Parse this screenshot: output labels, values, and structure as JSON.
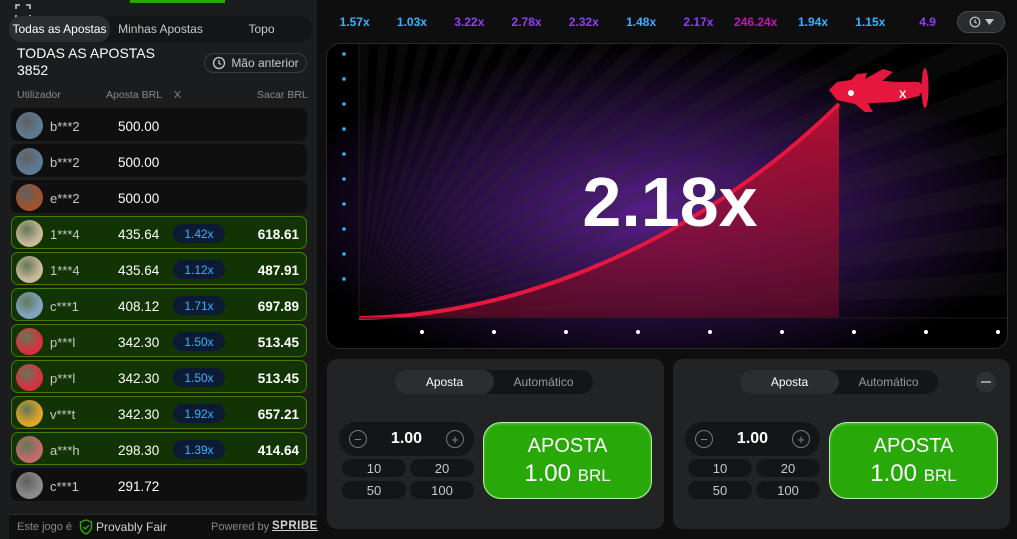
{
  "left": {
    "tabs": [
      "Todas as Apostas",
      "Minhas Apostas",
      "Topo"
    ],
    "all_title": "TODAS AS APOSTAS",
    "all_count": "3852",
    "prev_label": "Mão anterior",
    "columns": {
      "user": "Utilizador",
      "bet": "Aposta BRL",
      "x": "X",
      "cash": "Sacar BRL"
    },
    "rows": [
      {
        "user": "b***2",
        "bet": "500.00",
        "mult": "",
        "cash": "",
        "win": false,
        "avatar": "#5d7a94"
      },
      {
        "user": "b***2",
        "bet": "500.00",
        "mult": "",
        "cash": "",
        "win": false,
        "avatar": "#5d7a94"
      },
      {
        "user": "e***2",
        "bet": "500.00",
        "mult": "",
        "cash": "",
        "win": false,
        "avatar": "#a0522d"
      },
      {
        "user": "1***4",
        "bet": "435.64",
        "mult": "1.42x",
        "cash": "618.61",
        "win": true,
        "avatar": "#c9b89a"
      },
      {
        "user": "1***4",
        "bet": "435.64",
        "mult": "1.12x",
        "cash": "487.91",
        "win": true,
        "avatar": "#c9b89a"
      },
      {
        "user": "c***1",
        "bet": "408.12",
        "mult": "1.71x",
        "cash": "697.89",
        "win": true,
        "avatar": "#7fa3c4"
      },
      {
        "user": "p***l",
        "bet": "342.30",
        "mult": "1.50x",
        "cash": "513.45",
        "win": true,
        "avatar": "#d9303f"
      },
      {
        "user": "p***l",
        "bet": "342.30",
        "mult": "1.50x",
        "cash": "513.45",
        "win": true,
        "avatar": "#d9303f"
      },
      {
        "user": "v***t",
        "bet": "342.30",
        "mult": "1.92x",
        "cash": "657.21",
        "win": true,
        "avatar": "#e0a526"
      },
      {
        "user": "a***h",
        "bet": "298.30",
        "mult": "1.39x",
        "cash": "414.64",
        "win": true,
        "avatar": "#c46a6a"
      },
      {
        "user": "c***1",
        "bet": "291.72",
        "mult": "",
        "cash": "",
        "win": false,
        "avatar": "#8a8a8a"
      }
    ],
    "footer": {
      "this_game": "Este jogo é",
      "provably_fair": "Provably Fair",
      "powered_by": "Powered by",
      "spribe": "SPRIBE"
    }
  },
  "history": [
    {
      "v": "1.57x",
      "c": "#34b4ff"
    },
    {
      "v": "1.03x",
      "c": "#34b4ff"
    },
    {
      "v": "3.22x",
      "c": "#913ef8"
    },
    {
      "v": "2.78x",
      "c": "#913ef8"
    },
    {
      "v": "2.32x",
      "c": "#913ef8"
    },
    {
      "v": "1.48x",
      "c": "#34b4ff"
    },
    {
      "v": "2.17x",
      "c": "#913ef8"
    },
    {
      "v": "246.24x",
      "c": "#c017b4"
    },
    {
      "v": "1.94x",
      "c": "#34b4ff"
    },
    {
      "v": "1.15x",
      "c": "#34b4ff"
    },
    {
      "v": "4.9",
      "c": "#913ef8"
    }
  ],
  "game": {
    "multiplier": "2.18x"
  },
  "panels": [
    {
      "tab_bet": "Aposta",
      "tab_auto": "Automático",
      "amount": "1.00",
      "quick": [
        "10",
        "20",
        "50",
        "100"
      ],
      "btn_line1": "APOSTA",
      "btn_amount": "1.00",
      "btn_currency": "BRL"
    },
    {
      "tab_bet": "Aposta",
      "tab_auto": "Automático",
      "amount": "1.00",
      "quick": [
        "10",
        "20",
        "50",
        "100"
      ],
      "btn_line1": "APOSTA",
      "btn_amount": "1.00",
      "btn_currency": "BRL"
    }
  ]
}
